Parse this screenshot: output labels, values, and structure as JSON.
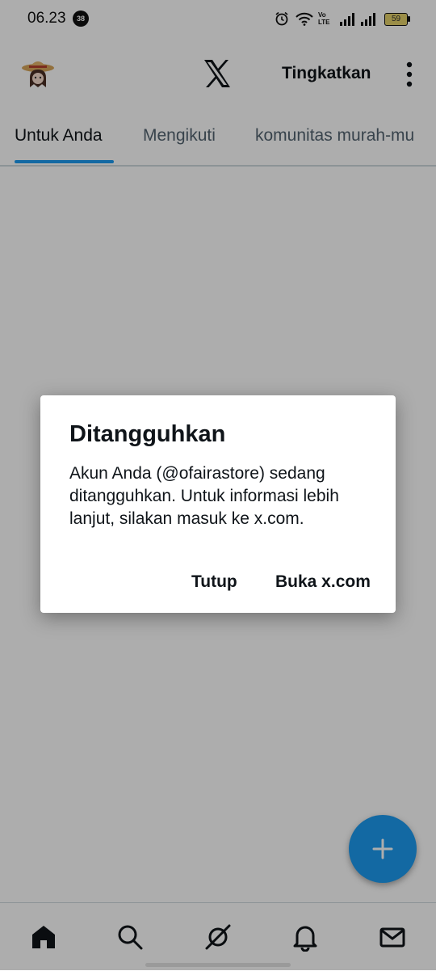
{
  "status_bar": {
    "time": "06.23",
    "notification_count": "38",
    "network_label_top": "Vo",
    "network_label_bottom": "LTE",
    "battery_level": "59"
  },
  "app_bar": {
    "upgrade_label": "Tingkatkan",
    "logo": "x-logo-icon"
  },
  "tabs": [
    {
      "label": "Untuk Anda",
      "active": true
    },
    {
      "label": "Mengikuti",
      "active": false
    },
    {
      "label": "komunitas murah-mu",
      "active": false
    }
  ],
  "dialog": {
    "title": "Ditangguhkan",
    "body": "Akun Anda (@ofairastore) sedang ditangguhkan. Untuk informasi lebih lanjut, silakan masuk ke x.com.",
    "dismiss_label": "Tutup",
    "open_label": "Buka x.com"
  },
  "bottom_nav": [
    "home-icon",
    "search-icon",
    "grok-icon",
    "notifications-icon",
    "messages-icon"
  ],
  "colors": {
    "accent": "#1d9bf0",
    "text": "#0f1419",
    "muted": "#536471"
  }
}
